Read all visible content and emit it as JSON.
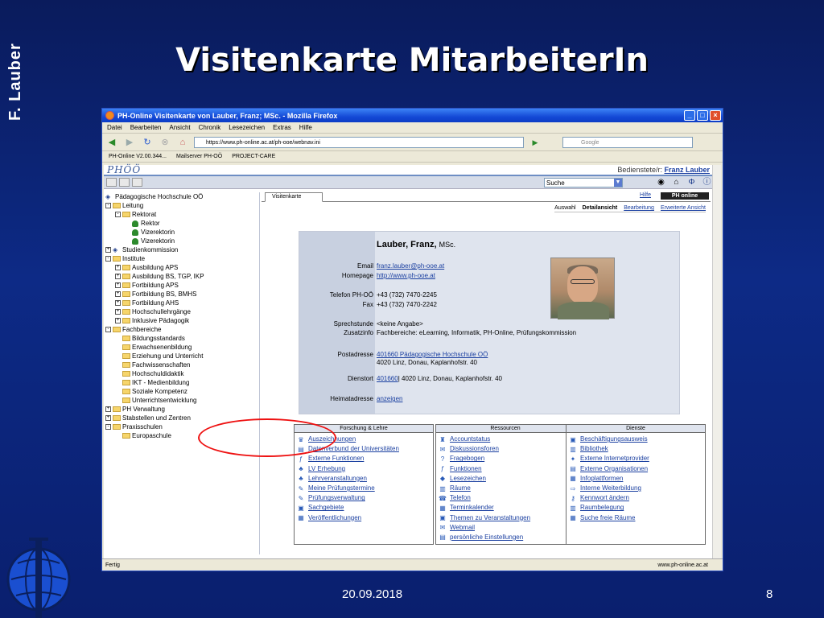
{
  "slide": {
    "author": "F. Lauber",
    "title": "Visitenkarte MitarbeiterIn",
    "date": "20.09.2018",
    "page": "8"
  },
  "browser": {
    "window_title": "PH-Online Visitenkarte von Lauber, Franz; MSc. - Mozilla Firefox",
    "menu": [
      "Datei",
      "Bearbeiten",
      "Ansicht",
      "Chronik",
      "Lesezeichen",
      "Extras",
      "Hilfe"
    ],
    "url": "https://www.ph-online.ac.at/ph-ooe/webnav.ini",
    "search_placeholder": "Google",
    "bookmarks": [
      "PH-Online V2.00.344...",
      "Mailserver PH-OÖ",
      "PROJECT-CARE"
    ],
    "status_left": "Fertig",
    "status_right": "www.ph-online.ac.at"
  },
  "app": {
    "logo": "PHÖÖ",
    "user_label": "Bedienstete/r:",
    "user_name": "Franz Lauber",
    "search_select": "Suche",
    "tab": "Visitenkarte",
    "help": "Hilfe",
    "ph_online": "PH online",
    "subtabs": [
      "Auswahl",
      "Detailansicht",
      "Bearbeitung",
      "Erweiterte Ansicht"
    ]
  },
  "tree": [
    {
      "label": "Pädagogische Hochschule OÖ",
      "indent": 0,
      "kind": "org"
    },
    {
      "label": "Leitung",
      "indent": 0,
      "kind": "folder",
      "box": "-"
    },
    {
      "label": "Rektorat",
      "indent": 1,
      "kind": "folder",
      "box": "-"
    },
    {
      "label": "Rektor",
      "indent": 2,
      "kind": "person"
    },
    {
      "label": "Vizerektorin",
      "indent": 2,
      "kind": "person"
    },
    {
      "label": "Vizerektorin",
      "indent": 2,
      "kind": "person"
    },
    {
      "label": "Studienkommission",
      "indent": 0,
      "kind": "org",
      "box": "+"
    },
    {
      "label": "Institute",
      "indent": 0,
      "kind": "folder",
      "box": "-"
    },
    {
      "label": "Ausbildung APS",
      "indent": 1,
      "kind": "folder",
      "box": "+"
    },
    {
      "label": "Ausbildung BS, TGP, IKP",
      "indent": 1,
      "kind": "folder",
      "box": "+"
    },
    {
      "label": "Fortbildung APS",
      "indent": 1,
      "kind": "folder",
      "box": "+"
    },
    {
      "label": "Fortbildung BS, BMHS",
      "indent": 1,
      "kind": "folder",
      "box": "+"
    },
    {
      "label": "Fortbildung AHS",
      "indent": 1,
      "kind": "folder",
      "box": "+"
    },
    {
      "label": "Hochschullehrgänge",
      "indent": 1,
      "kind": "folder",
      "box": "+"
    },
    {
      "label": "Inklusive Pädagogik",
      "indent": 1,
      "kind": "folder",
      "box": "+"
    },
    {
      "label": "Fachbereiche",
      "indent": 0,
      "kind": "folder",
      "box": "-"
    },
    {
      "label": "Bildungsstandards",
      "indent": 1,
      "kind": "folder"
    },
    {
      "label": "Erwachsenenbildung",
      "indent": 1,
      "kind": "folder"
    },
    {
      "label": "Erziehung und Unterricht",
      "indent": 1,
      "kind": "folder"
    },
    {
      "label": "Fachwissenschaften",
      "indent": 1,
      "kind": "folder"
    },
    {
      "label": "Hochschuldidaktik",
      "indent": 1,
      "kind": "folder"
    },
    {
      "label": "IKT - Medienbildung",
      "indent": 1,
      "kind": "folder"
    },
    {
      "label": "Soziale Kompetenz",
      "indent": 1,
      "kind": "folder"
    },
    {
      "label": "Unterrichtsentwicklung",
      "indent": 1,
      "kind": "folder"
    },
    {
      "label": "PH Verwaltung",
      "indent": 0,
      "kind": "folder",
      "box": "+"
    },
    {
      "label": "Stabstellen und Zentren",
      "indent": 0,
      "kind": "folder",
      "box": "+"
    },
    {
      "label": "Praxisschulen",
      "indent": 0,
      "kind": "folder",
      "box": "-"
    },
    {
      "label": "Europaschule",
      "indent": 1,
      "kind": "folder"
    }
  ],
  "card": {
    "name": "Lauber, Franz,",
    "title_suffix": "MSc.",
    "email_label": "Email",
    "email": "franz.lauber@ph-ooe.at",
    "homepage_label": "Homepage",
    "homepage": "http://www.ph-ooe.at",
    "phone_label": "Telefon PH-OÖ",
    "phone": "+43 (732) 7470-2245",
    "fax_label": "Fax",
    "fax": "+43 (732) 7470-2242",
    "office_hours_label": "Sprechstunde",
    "office_hours": "<keine Angabe>",
    "extra_label": "Zusatzinfo",
    "extra": "Fachbereiche: eLearning, Informatik, PH-Online, Prüfungskommission",
    "postal_label": "Postadresse",
    "postal_link": "401660 Pädagogische Hochschule OÖ",
    "postal_address": "4020 Linz, Donau, Kaplanhofstr. 40",
    "office_label": "Dienstort",
    "office_link": "401660",
    "office_address": "| 4020 Linz, Donau, Kaplanhofstr. 40",
    "home_label": "Heimatadresse",
    "home_link": "anzeigen"
  },
  "panels": [
    {
      "title": "Forschung & Lehre",
      "items": [
        {
          "label": "Auszeichnungen",
          "icon": "trophy-icon",
          "glyph": "♛"
        },
        {
          "label": "Datenverbund der Universitäten",
          "icon": "database-icon",
          "glyph": "▤"
        },
        {
          "label": "Externe Funktionen",
          "icon": "function-icon",
          "glyph": "ƒ"
        },
        {
          "label": "LV Erhebung",
          "icon": "people-icon",
          "glyph": "♣"
        },
        {
          "label": "Lehrveranstaltungen",
          "icon": "people-icon",
          "glyph": "♣"
        },
        {
          "label": "Meine Prüfungstermine",
          "icon": "exam-icon",
          "glyph": "✎"
        },
        {
          "label": "Prüfungsverwaltung",
          "icon": "exam-icon",
          "glyph": "✎"
        },
        {
          "label": "Sachgebiete",
          "icon": "topic-icon",
          "glyph": "▣"
        },
        {
          "label": "Veröffentlichungen",
          "icon": "publication-icon",
          "glyph": "▦"
        }
      ]
    },
    {
      "title": "Ressourcen",
      "items": [
        {
          "label": "Accountstatus",
          "icon": "account-icon",
          "glyph": "♜"
        },
        {
          "label": "Diskussionsforen",
          "icon": "forum-icon",
          "glyph": "✉"
        },
        {
          "label": "Fragebogen",
          "icon": "question-icon",
          "glyph": "?"
        },
        {
          "label": "Funktionen",
          "icon": "function-icon",
          "glyph": "ƒ"
        },
        {
          "label": "Lesezeichen",
          "icon": "bookmark-icon",
          "glyph": "◆"
        },
        {
          "label": "Räume",
          "icon": "room-icon",
          "glyph": "▥"
        },
        {
          "label": "Telefon",
          "icon": "phone-icon",
          "glyph": "☎"
        },
        {
          "label": "Terminkalender",
          "icon": "calendar-icon",
          "glyph": "▦"
        },
        {
          "label": "Themen zu Veranstaltungen",
          "icon": "topic-icon",
          "glyph": "▣"
        },
        {
          "label": "Webmail",
          "icon": "mail-icon",
          "glyph": "✉"
        },
        {
          "label": "persönliche Einstellungen",
          "icon": "settings-icon",
          "glyph": "▤"
        }
      ]
    },
    {
      "title": "Dienste",
      "items": [
        {
          "label": "Beschäftigungsausweis",
          "icon": "id-card-icon",
          "glyph": "▣"
        },
        {
          "label": "Bibliothek",
          "icon": "library-icon",
          "glyph": "▥"
        },
        {
          "label": "Externe Internetprovider",
          "icon": "globe-icon",
          "glyph": "✦"
        },
        {
          "label": "Externe Organisationen",
          "icon": "organization-icon",
          "glyph": "▤"
        },
        {
          "label": "Infoplattformen",
          "icon": "info-icon",
          "glyph": "▦"
        },
        {
          "label": "Interne Weiterbildung",
          "icon": "arrow-icon",
          "glyph": "⇨"
        },
        {
          "label": "Kennwort ändern",
          "icon": "key-icon",
          "glyph": "⚷"
        },
        {
          "label": "Raumbelegung",
          "icon": "room-icon",
          "glyph": "▥"
        },
        {
          "label": "Suche freie Räume",
          "icon": "search-room-icon",
          "glyph": "▦"
        }
      ]
    }
  ]
}
